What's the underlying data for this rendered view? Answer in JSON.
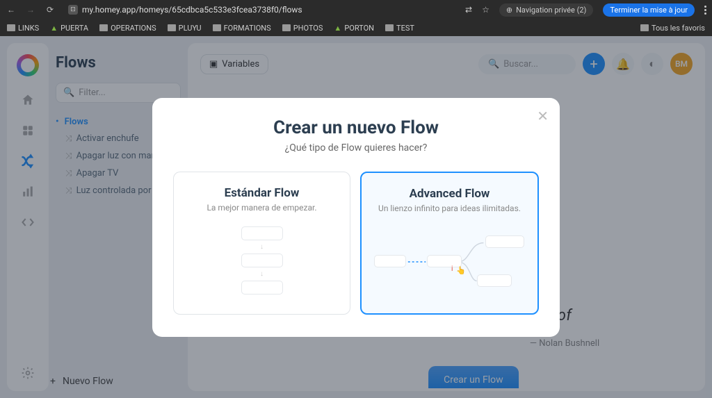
{
  "browser": {
    "url": "my.homey.app/homeys/65cdbca5c533e3fcea3738f0/flows",
    "privacy": "Navigation privée (2)",
    "update": "Terminer la mise à jour",
    "bookmarks": [
      "LINKS",
      "PUERTA",
      "OPERATIONS",
      "PLUYU",
      "FORMATIONS",
      "PHOTOS",
      "PORTON",
      "TEST"
    ],
    "all_favorites": "Tous les favoris"
  },
  "app": {
    "title": "Flows",
    "filter_placeholder": "Filter...",
    "variables_btn": "Variables",
    "search_placeholder": "Buscar...",
    "avatar": "BM",
    "new_flow": "Nuevo Flow",
    "tree_root": "Flows",
    "tree_items": [
      "Activar enchufe",
      "Apagar luz con mando",
      "Apagar TV",
      "Luz controlada por m"
    ]
  },
  "quote": {
    "text": "of",
    "author": "— Nolan Bushnell"
  },
  "cta": "Crear un Flow",
  "modal": {
    "title": "Crear un nuevo Flow",
    "subtitle": "¿Qué tipo de Flow quieres hacer?",
    "option1": {
      "title": "Estándar Flow",
      "desc": "La mejor manera de empezar."
    },
    "option2": {
      "title": "Advanced Flow",
      "desc": "Un lienzo infinito para ideas ilimitadas."
    }
  }
}
